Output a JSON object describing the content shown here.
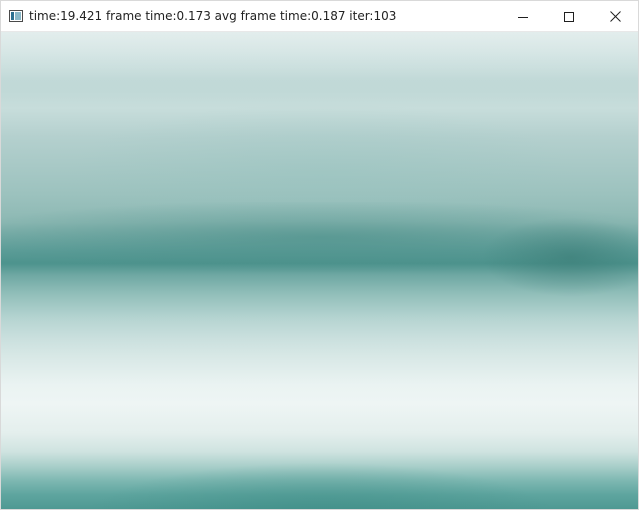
{
  "window": {
    "title": "time:19.421 frame time:0.173 avg frame time:0.187 iter:103",
    "app_icon": "window-app-icon",
    "controls": {
      "minimize_icon": "minimize-icon",
      "maximize_icon": "maximize-icon",
      "close_icon": "close-icon"
    }
  },
  "render": {
    "palette": {
      "teal_dark": "#4d938d",
      "teal_mid": "#8cb8b3",
      "mist_light": "#eef5f4"
    }
  }
}
